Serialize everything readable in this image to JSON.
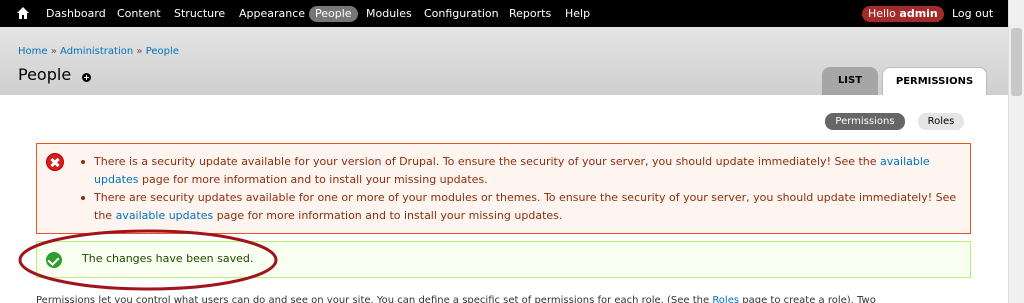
{
  "toolbar": {
    "items": [
      "Dashboard",
      "Content",
      "Structure",
      "Appearance",
      "People",
      "Modules",
      "Configuration",
      "Reports",
      "Help"
    ],
    "active": "People",
    "hello_prefix": "Hello",
    "user": "admin",
    "logout": "Log out"
  },
  "breadcrumb": {
    "home": "Home",
    "separator": "»",
    "admin": "Administration",
    "people": "People"
  },
  "page": {
    "title": "People"
  },
  "tabs": {
    "list": "LIST",
    "permissions": "PERMISSIONS"
  },
  "subtabs": {
    "permissions": "Permissions",
    "roles": "Roles"
  },
  "messages": {
    "error_1": {
      "before": "There is a security update available for your version of Drupal. To ensure the security of your server, you should update immediately! See the ",
      "link": "available updates",
      "after": " page for more information and to install your missing updates."
    },
    "error_2": {
      "before": "There are security updates available for one or more of your modules or themes. To ensure the security of your server, you should update immediately! See the ",
      "link": "available updates",
      "after": " page for more information and to install your missing updates."
    },
    "status": "The changes have been saved."
  },
  "description": {
    "before": "Permissions let you control what users can do and see on your site. You can define a specific set of permissions for each role. (See the ",
    "link": "Roles",
    "after": " page to create a role). Two"
  },
  "colors": {
    "error_border": "#ed541d",
    "status_border": "#bbee77",
    "annotation": "#a0141e",
    "link": "#0074bd"
  }
}
